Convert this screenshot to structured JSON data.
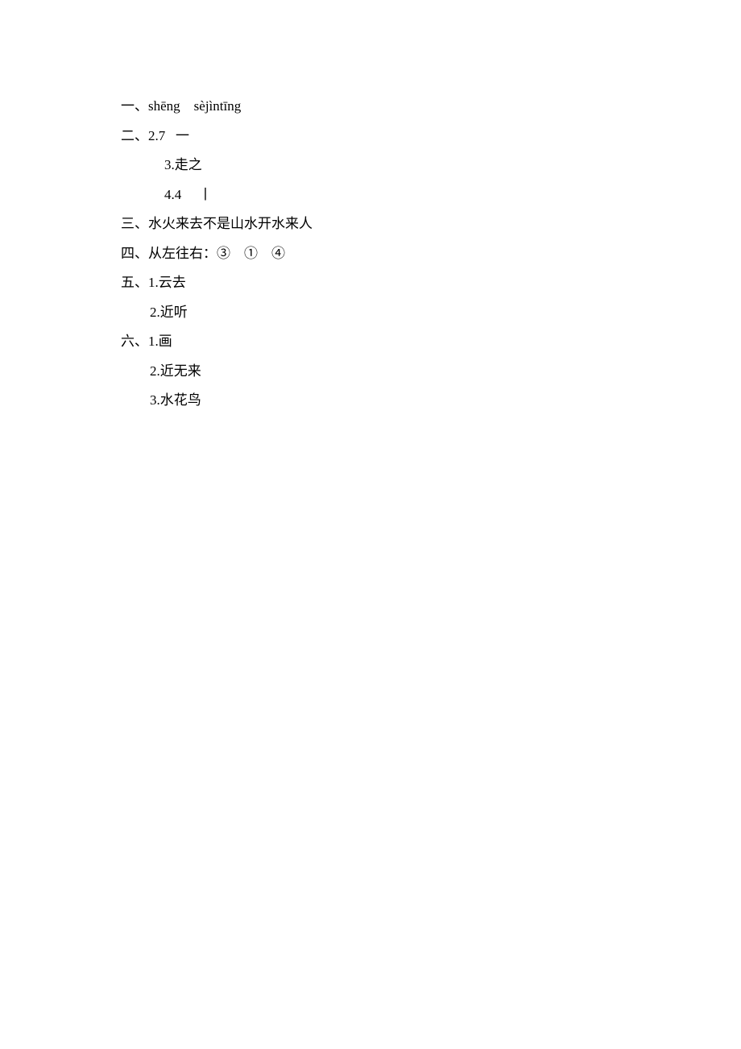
{
  "lines": {
    "l1": "一、shēng    sèjìntīng",
    "l2": "二、2.7   一",
    "l3": "3.走之",
    "l4": "4.4     丨",
    "l5": "三、水火来去不是山水开水来人",
    "l6": "四、从左往右：③    ①    ④",
    "l7": "五、1.云去",
    "l8": "2.近听",
    "l9": "六、1.画",
    "l10": "2.近无来",
    "l11": "3.水花鸟"
  }
}
